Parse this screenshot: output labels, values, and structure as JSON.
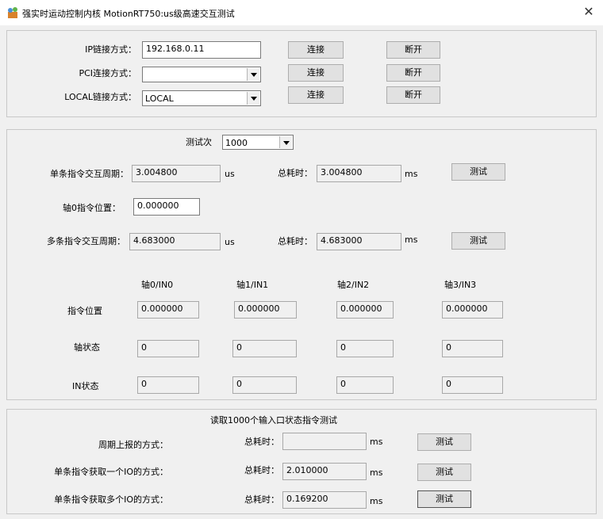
{
  "window": {
    "title": "强实时运动控制内核 MotionRT750:us级高速交互测试",
    "close_glyph": "✕"
  },
  "connection": {
    "ip_label": "IP链接方式：",
    "ip_value": "192.168.0.11",
    "pci_label": "PCI连接方式：",
    "pci_value": "",
    "local_label": "LOCAL链接方式：",
    "local_value": "LOCAL",
    "connect_label": "连接",
    "disconnect_label": "断开"
  },
  "test": {
    "count_label": "测试次",
    "count_value": "1000",
    "single_label": "单条指令交互周期：",
    "single_value": "3.004800",
    "single_unit": "us",
    "single_total_label": "总耗时：",
    "single_total_value": "3.004800",
    "single_total_unit": "ms",
    "test_label": "测试",
    "axis0_label": "轴0指令位置：",
    "axis0_value": "0.000000",
    "multi_label": "多条指令交互周期：",
    "multi_value": "4.683000",
    "multi_unit": "us",
    "multi_total_label": "总耗时：",
    "multi_total_value": "4.683000",
    "multi_total_unit": "ms"
  },
  "axes": {
    "headers": [
      "轴0/IN0",
      "轴1/IN1",
      "轴2/IN2",
      "轴3/IN3"
    ],
    "row_labels": [
      "指令位置",
      "轴状态",
      "IN状态"
    ],
    "positions": [
      "0.000000",
      "0.000000",
      "0.000000",
      "0.000000"
    ],
    "status": [
      "0",
      "0",
      "0",
      "0"
    ],
    "in_status": [
      "0",
      "0",
      "0",
      "0"
    ]
  },
  "io_test": {
    "title": "读取1000个输入口状态指令测试",
    "rows": [
      {
        "label": "周期上报的方式：",
        "total_label": "总耗时：",
        "value": "",
        "unit": "ms",
        "button": "测试"
      },
      {
        "label": "单条指令获取一个IO的方式：",
        "total_label": "总耗时：",
        "value": "2.010000",
        "unit": "ms",
        "button": "测试"
      },
      {
        "label": "单条指令获取多个IO的方式：",
        "total_label": "总耗时：",
        "value": "0.169200",
        "unit": "ms",
        "button": "测试"
      }
    ]
  }
}
